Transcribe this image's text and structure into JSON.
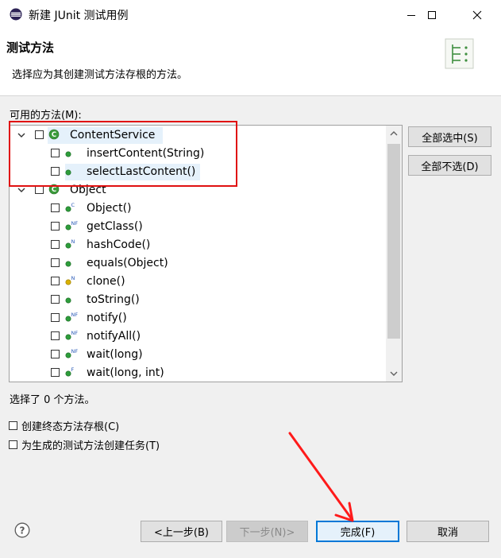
{
  "window": {
    "title": "新建 JUnit 测试用例"
  },
  "banner": {
    "title": "测试方法",
    "description": "选择应为其创建测试方法存根的方法。"
  },
  "methods": {
    "label": "可用的方法(M):",
    "tree": [
      {
        "label": "ContentService",
        "kind": "class",
        "expanded": true,
        "checked": false,
        "selected": true
      },
      {
        "label": "insertContent(String)",
        "kind": "method-public",
        "checked": false
      },
      {
        "label": "selectLastContent()",
        "kind": "method-public",
        "checked": false,
        "selected": true
      },
      {
        "label": "Object",
        "kind": "class",
        "expanded": true,
        "checked": false
      },
      {
        "label": "Object()",
        "kind": "constructor",
        "modifier": "C",
        "checked": false
      },
      {
        "label": "getClass()",
        "kind": "method-public",
        "modifier": "NF",
        "checked": false
      },
      {
        "label": "hashCode()",
        "kind": "method-public",
        "modifier": "N",
        "checked": false
      },
      {
        "label": "equals(Object)",
        "kind": "method-public",
        "checked": false
      },
      {
        "label": "clone()",
        "kind": "method-protected",
        "modifier": "N",
        "checked": false
      },
      {
        "label": "toString()",
        "kind": "method-public",
        "checked": false
      },
      {
        "label": "notify()",
        "kind": "method-public",
        "modifier": "NF",
        "checked": false
      },
      {
        "label": "notifyAll()",
        "kind": "method-public",
        "modifier": "NF",
        "checked": false
      },
      {
        "label": "wait(long)",
        "kind": "method-public",
        "modifier": "NF",
        "checked": false
      },
      {
        "label": "wait(long, int)",
        "kind": "method-public",
        "modifier": "F",
        "checked": false
      }
    ],
    "select_all_label": "全部选中(S)",
    "deselect_all_label": "全部不选(D)",
    "summary": "选择了 0 个方法。"
  },
  "options": {
    "final_stubs_label": "创建终态方法存根(C)",
    "final_stubs_checked": false,
    "tasks_label": "为生成的测试方法创建任务(T)",
    "tasks_checked": false
  },
  "footer": {
    "back_label": "<上一步(B)",
    "next_label": "下一步(N)>",
    "finish_label": "完成(F)",
    "cancel_label": "取消"
  },
  "colors": {
    "annotation": "#e01010",
    "selection": "#e5f1fb",
    "class_icon": "#3a9b3a",
    "method_public": "#2e9d3b",
    "method_protected": "#d9b000",
    "modifier_text": "#2a5ab8",
    "default_button_border": "#0078d7"
  }
}
